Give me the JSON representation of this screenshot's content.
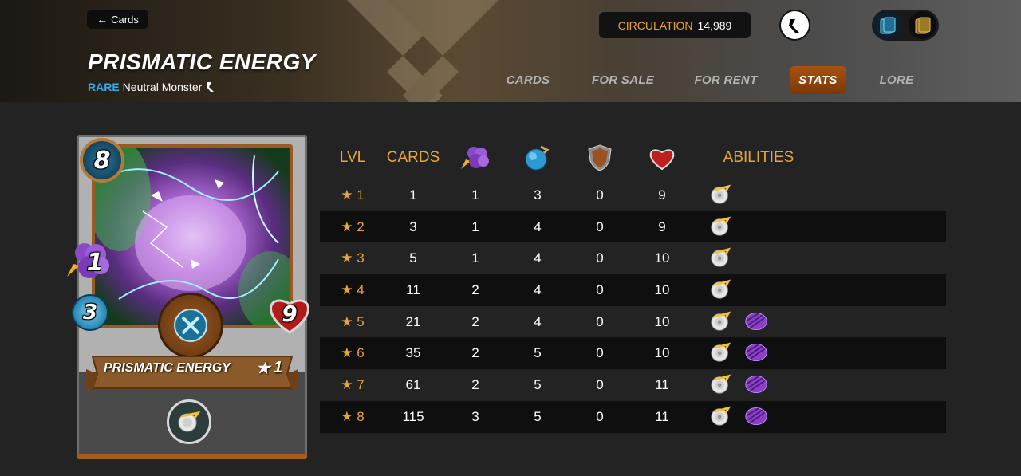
{
  "nav": {
    "back_label": "Cards",
    "back_icon": "arrow-left-icon"
  },
  "card": {
    "name": "PRISMATIC ENERGY",
    "rarity": "RARE",
    "type": "Neutral Monster",
    "edition_icon": "edition-icon",
    "mana": "8",
    "magic": "1",
    "speed": "3",
    "health": "9",
    "level": "1",
    "level_star": "★",
    "banner_name": "PRISMATIC ENERGY"
  },
  "header": {
    "circulation_label": "CIRCULATION",
    "circulation_value": "14,989"
  },
  "tabs": [
    {
      "label": "CARDS",
      "active": false
    },
    {
      "label": "FOR SALE",
      "active": false
    },
    {
      "label": "FOR RENT",
      "active": false
    },
    {
      "label": "STATS",
      "active": true
    },
    {
      "label": "LORE",
      "active": false
    }
  ],
  "stats": {
    "headers": {
      "lvl": "LVL",
      "cards": "CARDS",
      "magic_icon": "magic-attack-icon",
      "speed_icon": "speed-icon",
      "armor_icon": "armor-icon",
      "health_icon": "health-icon",
      "abilities": "ABILITIES"
    },
    "rows": [
      {
        "lvl": "★ 1",
        "cards": "1",
        "magic": "1",
        "speed": "3",
        "armor": "0",
        "health": "9",
        "abilities": [
          "ability-icon"
        ]
      },
      {
        "lvl": "★ 2",
        "cards": "3",
        "magic": "1",
        "speed": "4",
        "armor": "0",
        "health": "9",
        "abilities": [
          "ability-icon"
        ]
      },
      {
        "lvl": "★ 3",
        "cards": "5",
        "magic": "1",
        "speed": "4",
        "armor": "0",
        "health": "10",
        "abilities": [
          "ability-icon"
        ]
      },
      {
        "lvl": "★ 4",
        "cards": "11",
        "magic": "2",
        "speed": "4",
        "armor": "0",
        "health": "10",
        "abilities": [
          "ability-icon"
        ]
      },
      {
        "lvl": "★ 5",
        "cards": "21",
        "magic": "2",
        "speed": "4",
        "armor": "0",
        "health": "10",
        "abilities": [
          "ability-icon",
          "void-armor-icon"
        ]
      },
      {
        "lvl": "★ 6",
        "cards": "35",
        "magic": "2",
        "speed": "5",
        "armor": "0",
        "health": "10",
        "abilities": [
          "ability-icon",
          "void-armor-icon"
        ]
      },
      {
        "lvl": "★ 7",
        "cards": "61",
        "magic": "2",
        "speed": "5",
        "armor": "0",
        "health": "11",
        "abilities": [
          "ability-icon",
          "void-armor-icon"
        ]
      },
      {
        "lvl": "★ 8",
        "cards": "115",
        "magic": "3",
        "speed": "5",
        "armor": "0",
        "health": "11",
        "abilities": [
          "ability-icon",
          "void-armor-icon"
        ]
      }
    ]
  },
  "colors": {
    "accent": "#e8a33a",
    "rarity": "#38a9e6",
    "active_tab": "#a8520f"
  }
}
